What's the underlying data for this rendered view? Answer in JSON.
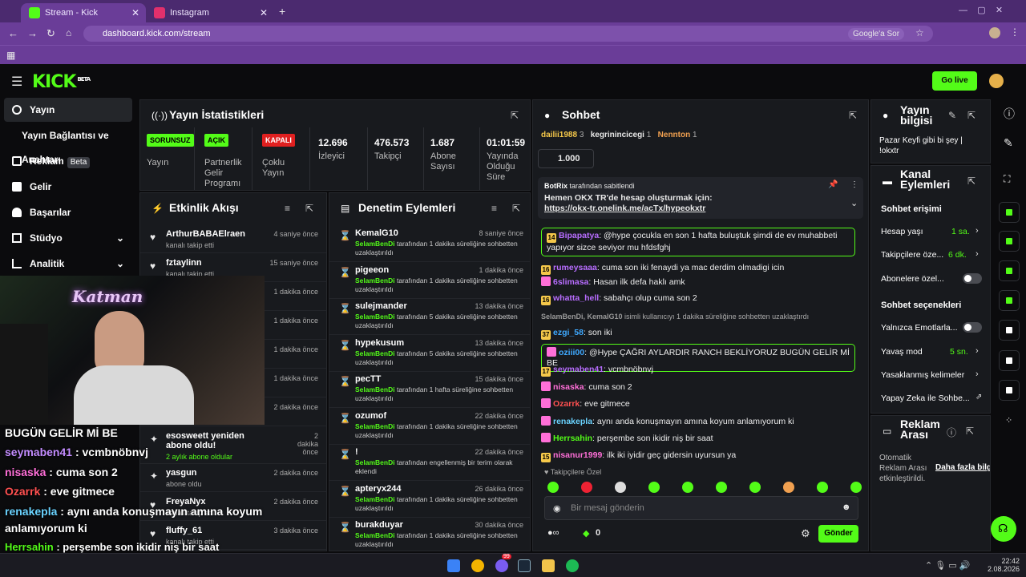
{
  "browser": {
    "tabs": [
      {
        "label": "Stream - Kick Dashboard"
      },
      {
        "label": "Instagram"
      }
    ],
    "url": "dashboard.kick.com/stream",
    "search_btn": "Google'a Sor"
  },
  "kick": {
    "logo": "KICK",
    "logo_sup": "BETA",
    "go_live": "Go live"
  },
  "sidebar": {
    "items": [
      {
        "label": "Yayın"
      },
      {
        "label": "Yayın Bağlantısı ve Anahtarı"
      },
      {
        "label": "Reklam",
        "badge": "Beta"
      },
      {
        "label": "Gelir"
      },
      {
        "label": "Başarılar"
      },
      {
        "label": "Stüdyo"
      },
      {
        "label": "Analitik"
      }
    ]
  },
  "stats": {
    "title": "Yayın İstatistikleri",
    "boxes": [
      {
        "badge": "SORUNSUZ",
        "label": "Yayın"
      },
      {
        "badge": "AÇIK",
        "label": "Partnerlik Gelir Programı"
      },
      {
        "badge": "KAPALI",
        "label": "Çoklu Yayın"
      },
      {
        "num": "12.696",
        "label": "İzleyici"
      },
      {
        "num": "476.573",
        "label": "Takipçi"
      },
      {
        "num": "1.687",
        "label": "Abone Sayısı"
      },
      {
        "num": "01:01:59",
        "label": "Yayında Olduğu Süre"
      }
    ]
  },
  "activity": {
    "title": "Etkinlik Akışı",
    "rows": [
      {
        "name": "ArthurBABAElraen",
        "sub": "kanalı takip etti",
        "time": "4 saniye önce"
      },
      {
        "name": "fztaylinn",
        "sub": "kanalı takip etti",
        "time": "15 saniye önce"
      },
      {
        "time": "1 dakika önce"
      },
      {
        "time": "1 dakika önce"
      },
      {
        "time": "1 dakika önce"
      },
      {
        "time": "1 dakika önce"
      },
      {
        "time": "2 dakika önce"
      },
      {
        "name": "esosweett yeniden abone oldu!",
        "sub": "2 aylık abone oldular",
        "time": "2 dakika önce"
      },
      {
        "name": "yasgun",
        "sub": "abone oldu",
        "time": "2 dakika önce"
      },
      {
        "name": "FreyaNyx",
        "sub": "kanalı takip etti",
        "time": "2 dakika önce"
      },
      {
        "name": "fluffy_61",
        "sub": "kanalı takip etti",
        "time": "3 dakika önce"
      }
    ]
  },
  "moderation": {
    "title": "Denetim Eylemleri",
    "rows": [
      {
        "name": "KemalG10",
        "mod": "SelamBenDi",
        "desc": " tarafından 1 dakika süreliğine sohbetten uzaklaştırıldı",
        "time": "8 saniye önce"
      },
      {
        "name": "pigeeon",
        "mod": "SelamBenDi",
        "desc": " tarafından 1 dakika süreliğine sohbetten uzaklaştırıldı",
        "time": "1 dakika önce"
      },
      {
        "name": "sulejmander",
        "mod": "SelamBenDi",
        "desc": " tarafından 5 dakika süreliğine sohbetten uzaklaştırıldı",
        "time": "13 dakika önce"
      },
      {
        "name": "hypekusum",
        "mod": "SelamBenDi",
        "desc": " tarafından 5 dakika süreliğine sohbetten uzaklaştırıldı",
        "time": "13 dakika önce"
      },
      {
        "name": "pecTT",
        "mod": "SelamBenDi",
        "desc": " tarafından 1 hafta süreliğine sohbetten uzaklaştırıldı",
        "time": "15 dakika önce"
      },
      {
        "name": "ozumof",
        "mod": "SelamBenDi",
        "desc": " tarafından 1 dakika süreliğine sohbetten uzaklaştırıldı",
        "time": "22 dakika önce"
      },
      {
        "name": "!",
        "mod": "SelamBenDi",
        "desc": " tarafından engellenmiş bir terim olarak eklendi",
        "time": "22 dakika önce"
      },
      {
        "name": "apteryx244",
        "mod": "SelamBenDi",
        "desc": " tarafından 1 dakika süreliğine sohbetten uzaklaştırıldı",
        "time": "26 dakika önce"
      },
      {
        "name": "burakduyar",
        "mod": "SelamBenDi",
        "desc": " tarafından 1 dakika süreliğine sohbetten uzaklaştırıldı",
        "time": "30 dakika önce"
      }
    ]
  },
  "chat": {
    "title": "Sohbet",
    "top": [
      {
        "name": "dailii1988",
        "n": "3"
      },
      {
        "name": "kegrinincicegi",
        "n": "1"
      },
      {
        "name": "Nennton",
        "n": "1"
      }
    ],
    "gift": "1.000",
    "pinned": {
      "by": "BotRix",
      "label": "tarafından sabitlendi",
      "text": "Hemen OKX TR'de hesap oluşturmak için: ",
      "link": "https://okx-tr.onelink.me/acTx/hypeokxtr"
    },
    "messages": [
      {
        "user": "Bipapatya",
        "color": "#b86dff",
        "text": ": @hype çocukla en son 1 hafta buluştuk şimdi de ev muhabbeti yapıyor sizce seviyor mu hfdsfghj",
        "hl": true,
        "badge": "14"
      },
      {
        "user": "rumeysaaa",
        "color": "#b86dff",
        "text": ": cuma son iki fenaydi ya mac derdim olmadigi icin",
        "badge": "16"
      },
      {
        "user": "6slimasa",
        "color": "#b86dff",
        "text": ": Hasan ilk defa haklı amk",
        "badge": ""
      },
      {
        "user": "whatta_hell",
        "color": "#b86dff",
        "text": ": sabahçı olup cuma son 2",
        "badge": "16"
      },
      {
        "user": "SelamBenDi, KemalG10",
        "color": "#999",
        "text": " isimli kullanıcıyı 1 dakika süreliğine sohbetten uzaklaştırdı",
        "sys": true
      },
      {
        "user": "ezgi_58",
        "color": "#3fa9ff",
        "text": ": son iki",
        "badge": "37"
      },
      {
        "user": "oziii00",
        "color": "#3fa9ff",
        "text": ": @Hype ÇAĞRI AYLARDIR RANCH BEKLİYORUZ BUGÜN GELİR Mİ BE",
        "hl": true,
        "badge": ""
      },
      {
        "user": "seymaben41",
        "color": "#b86dff",
        "text": ": vcmbnöbnvj",
        "badge": "17"
      },
      {
        "user": "nisaska",
        "color": "#ff6fd8",
        "text": ": cuma son 2",
        "badge": ""
      },
      {
        "user": "Ozarrk",
        "color": "#ff5050",
        "text": ": eve gitmece",
        "badge": ""
      },
      {
        "user": "renakepla",
        "color": "#6ad3ff",
        "text": ": aynı anda konuşmayın amına koyum anlamıyorum ki",
        "badge": ""
      },
      {
        "user": "Herrsahin",
        "color": "#53fc18",
        "text": ": perşembe son ikidir niş bir saat",
        "badge": ""
      },
      {
        "user": "nisanur1999",
        "color": "#ff6fd8",
        "text": ": ilk iki iyidir geç gidersin uyursun ya",
        "badge": "15"
      }
    ],
    "followers_label": "Takipçilere Özel",
    "placeholder": "Bir mesaj gönderin",
    "count": "0",
    "send": "Gönder"
  },
  "info": {
    "title": "Yayın bilgisi",
    "text": "Pazar Keyfi gibi bi şey | !okxtr"
  },
  "channel": {
    "title": "Kanal Eylemleri",
    "chat_access": "Sohbet erişimi",
    "account_age": "Hesap yaşı",
    "account_age_val": "1 sa.",
    "followers_only": "Takipçilere öze...",
    "followers_only_val": "6 dk.",
    "subs_only": "Abonelere özel...",
    "chat_options": "Sohbet seçenekleri",
    "emotes_only": "Yalnızca Emotlarla...",
    "slow_mode": "Yavaş mod",
    "slow_mode_val": "5 sn.",
    "banned_words": "Yasaklanmış kelimeler",
    "ai": "Yapay Zeka ile Sohbe..."
  },
  "ads": {
    "title": "Reklam Arası",
    "auto": "Otomatik Reklam Arası etkinleştirildi.",
    "more": "Daha fazla bilgi"
  },
  "overlay": {
    "lines": [
      {
        "t": "BUGÜN GELİR Mİ BE",
        "c": "#fff"
      },
      {
        "u": "seymaben41",
        "t": " : vcmbnöbnvj",
        "c": "#c38cff"
      },
      {
        "u": "nisaska",
        "t": " : cuma son 2",
        "c": "#ff6fd8"
      },
      {
        "u": "Ozarrk",
        "t": " : eve gitmece",
        "c": "#ff5050"
      },
      {
        "u": "renakepla",
        "t": " : aynı anda konuşmayın amına koyum",
        "c": "#6ad3ff"
      },
      {
        "t": "anlamıyorum ki",
        "c": "#fff"
      },
      {
        "u": "Herrsahin",
        "t": " : perşembe son ikidir niş bir saat",
        "c": "#53fc18"
      },
      {
        "u": "nisanur1999",
        "t": " : ilk iki iyidir geç gidersin uyursun ya",
        "c": "#ff6fd8"
      }
    ],
    "cam_text": "Katman"
  },
  "taskbar": {
    "time": "22:42",
    "date": "2.08.2026",
    "badge": "99"
  },
  "colors": {
    "accent": "#53fc18",
    "browser": "#6a3d98"
  }
}
